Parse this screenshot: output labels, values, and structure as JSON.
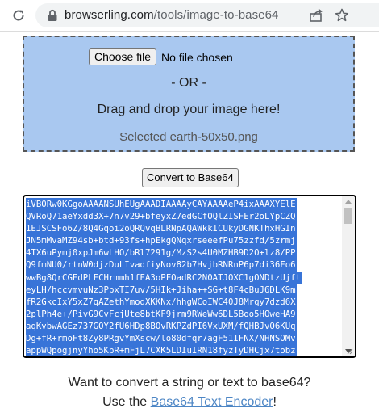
{
  "browser": {
    "url_domain": "browserling.com",
    "url_path": "/tools/image-to-base64",
    "icons": [
      "reload-icon",
      "lock-icon",
      "share-icon",
      "star-icon"
    ]
  },
  "upload": {
    "choose_file_label": "Choose file",
    "no_file_text": "No file chosen",
    "or_text": "- OR -",
    "drag_text": "Drag and drop your image here!",
    "selected_text": "Selected earth-50x50.png"
  },
  "convert_button_label": "Convert to Base64",
  "output": {
    "lines": [
      "iVBORw0KGgoAAAANSUhEUgAAADIAAAAyCAYAAAAeP4ixAAAXYElE",
      "QVRoQ71aeYxdd3X+7n7v29+bfeyxZ7edGCfOQlZISFEr2oLYpCZQ",
      "1EJSCSFo6Z/8Q4Gqoi2oQRQvqBLRNpAQAWkkICUkyDGNKThxHGIn",
      "JN5mMvaMZ94sb+btd+93fs+hpEkgQNqxrseeefPu75zzfd/5zrmj",
      "4TX6uPymj0xpJm6wLHO/bRl7291g/MzS2s4U0MZHB9D2O+lz8/PP",
      "Q9fmNU0/rtnW0djzDuLIvadfiyNov82b7HvjbRNRnP6p7di36Fo6",
      "wwBg8QrCGEdPLFCHrmmh1fEA3oPFOadRC2N0ATJOXC1gONDtzUjft",
      "eyLH/hccvmvuNz3PbxTI7uv/5HIk+Jiha++SG+t8F4cBuJ6DLK9m",
      "fR2GkcIxY5xZ7qAZethYmodXKKNx/hhgWCoIWC40J8Mrqy7dzd6X",
      "2plPh4e+/PivG9CvFcjUte8btKF9jrm9RWeWw6DL5Boo5HOweHA9",
      "aqKvbwAGEz737GOY2fU6HDp8BOvRKPZdPI6VxUXM/fQHBJvO6KUq",
      "Dg+fR+rmoFt8Zy8PRgvYmXscw/lo80dfqr7agF51IFNX/NHNSOMv",
      "appWQpogjnyYho5KpR+mFjL7CXK5LDIuIRN18fyzTyDHCjx7tobz"
    ]
  },
  "footer": {
    "question": "Want to convert a string or text to base64?",
    "use_prefix": "Use the ",
    "link_text": "Base64 Text Encoder",
    "use_suffix": "!"
  },
  "colors": {
    "dropzone_bg": "#a9c8f0",
    "selection_bg": "#3874d8",
    "link": "#4d86c5"
  }
}
